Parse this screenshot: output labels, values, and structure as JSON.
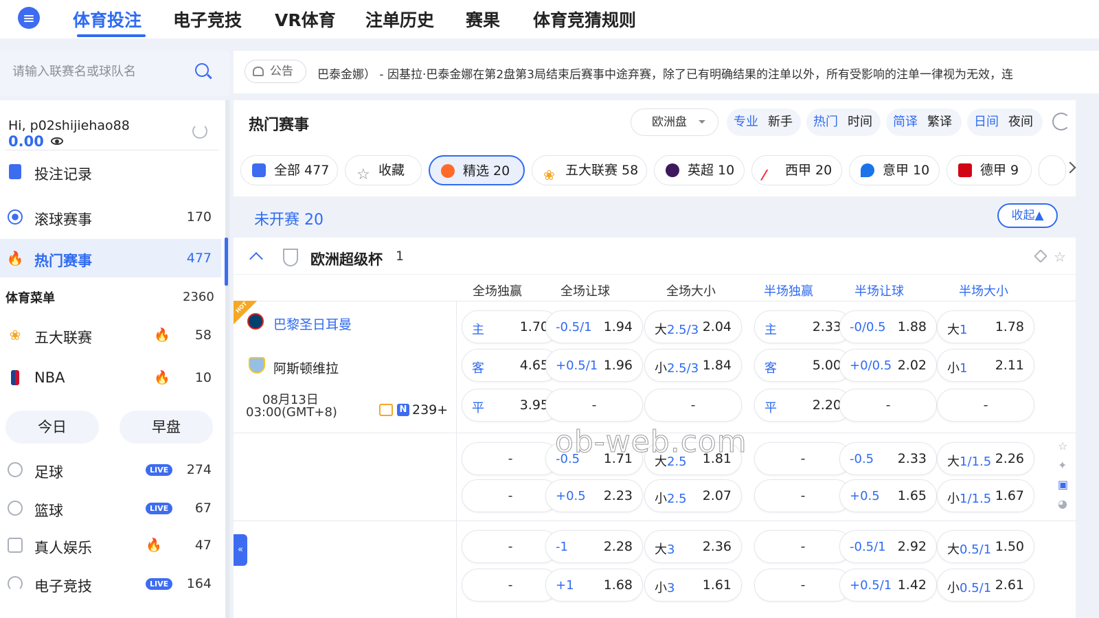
{
  "nav": {
    "items": [
      "体育投注",
      "电子竞技",
      "VR体育",
      "注单历史",
      "赛果",
      "体育竞猜规则"
    ],
    "active": "体育投注"
  },
  "search": {
    "placeholder": "请输入联赛名或球队名"
  },
  "user": {
    "greeting": "Hi, p02shijiehao88",
    "balance": "0.00"
  },
  "sidebar": {
    "bet_records": "投注记录",
    "live_matches": {
      "label": "滚球赛事",
      "count": "170"
    },
    "hot_matches": {
      "label": "热门赛事",
      "count": "477"
    },
    "sports_menu": {
      "label": "体育菜单",
      "count": "2360"
    },
    "leagues": [
      {
        "label": "五大联赛",
        "count": "58"
      },
      {
        "label": "NBA",
        "count": "10"
      }
    ],
    "tabs": [
      "今日",
      "早盘"
    ],
    "sports": [
      {
        "label": "足球",
        "badge": "LIVE",
        "count": "274"
      },
      {
        "label": "篮球",
        "badge": "LIVE",
        "count": "67"
      },
      {
        "label": "真人娱乐",
        "badge": "fire",
        "count": "47"
      },
      {
        "label": "电子竞技",
        "badge": "LIVE",
        "count": "164"
      }
    ],
    "collapse_symbol": "«"
  },
  "announcement": {
    "tag": "公告",
    "text": "巴泰金娜） - 因基拉·巴泰金娜在第2盘第3局结束后赛事中途弃赛，除了已有明确结果的注单以外，所有受影响的注单一律视为无效，连"
  },
  "main": {
    "title": "热门赛事",
    "odds_type": "欧洲盘",
    "toggles": [
      {
        "on": "专业",
        "off": "新手"
      },
      {
        "on": "热门",
        "off": "时间"
      },
      {
        "on": "简译",
        "off": "繁译"
      },
      {
        "on": "日间",
        "off": "夜间"
      }
    ],
    "chips": [
      {
        "label": "全部 477"
      },
      {
        "label": "收藏"
      },
      {
        "label": "精选 20"
      },
      {
        "label": "五大联赛 58"
      },
      {
        "label": "英超 10"
      },
      {
        "label": "西甲 20"
      },
      {
        "label": "意甲 10"
      },
      {
        "label": "德甲 9"
      }
    ],
    "not_started": "未开赛 20",
    "collapse_label": "收起▲",
    "league": {
      "name": "欧洲超级杯",
      "count": "1"
    },
    "columns": [
      "全场独赢",
      "全场让球",
      "全场大小",
      "半场独赢",
      "半场让球",
      "半场大小"
    ],
    "hot_tag": "HOT",
    "match": {
      "home": "巴黎圣日耳曼",
      "away": "阿斯顿维拉",
      "date": "08月13日",
      "time": "03:00(GMT+8)",
      "n_badge": "N",
      "more": "239+"
    },
    "rows": [
      [
        {
          "lb": "主",
          "od": "1.70"
        },
        {
          "lb": "-0.5/1",
          "od": "1.94"
        },
        {
          "lbp": "大",
          "lb": "2.5/3",
          "od": "2.04"
        },
        {
          "lb": "主",
          "od": "2.33"
        },
        {
          "lb": "-0/0.5",
          "od": "1.88"
        },
        {
          "lbp": "大",
          "lb": "1",
          "od": "1.78"
        }
      ],
      [
        {
          "lb": "客",
          "od": "4.65"
        },
        {
          "lb": "+0.5/1",
          "od": "1.96"
        },
        {
          "lbp": "小",
          "lb": "2.5/3",
          "od": "1.84"
        },
        {
          "lb": "客",
          "od": "5.00"
        },
        {
          "lb": "+0/0.5",
          "od": "2.02"
        },
        {
          "lbp": "小",
          "lb": "1",
          "od": "2.11"
        }
      ],
      [
        {
          "lb": "平",
          "od": "3.95"
        },
        {
          "dash": "-"
        },
        {
          "dash": "-"
        },
        {
          "lb": "平",
          "od": "2.20"
        },
        {
          "dash": "-"
        },
        {
          "dash": "-"
        }
      ],
      [
        {
          "dash": "-"
        },
        {
          "lb": "-0.5",
          "od": "1.71"
        },
        {
          "lbp": "大",
          "lb": "2.5",
          "od": "1.81"
        },
        {
          "dash": "-"
        },
        {
          "lb": "-0.5",
          "od": "2.33"
        },
        {
          "lbp": "大",
          "lb": "1/1.5",
          "od": "2.26"
        }
      ],
      [
        {
          "dash": "-"
        },
        {
          "lb": "+0.5",
          "od": "2.23"
        },
        {
          "lbp": "小",
          "lb": "2.5",
          "od": "2.07"
        },
        {
          "dash": "-"
        },
        {
          "lb": "+0.5",
          "od": "1.65"
        },
        {
          "lbp": "小",
          "lb": "1/1.5",
          "od": "1.67"
        }
      ],
      [
        {
          "dash": "-"
        },
        {
          "lb": "-1",
          "od": "2.28"
        },
        {
          "lbp": "大",
          "lb": "3",
          "od": "2.36"
        },
        {
          "dash": "-"
        },
        {
          "lb": "-0.5/1",
          "od": "2.92"
        },
        {
          "lbp": "大",
          "lb": "0.5/1",
          "od": "1.50"
        }
      ],
      [
        {
          "dash": "-"
        },
        {
          "lb": "+1",
          "od": "1.68"
        },
        {
          "lbp": "小",
          "lb": "3",
          "od": "1.61"
        },
        {
          "dash": "-"
        },
        {
          "lb": "+0.5/1",
          "od": "1.42"
        },
        {
          "lbp": "小",
          "lb": "0.5/1",
          "od": "2.61"
        }
      ]
    ]
  },
  "watermark": "ob-web.com",
  "colors": {
    "accent": "#2f6bf0",
    "hot": "#f6a723",
    "fire": "#ff5a1f"
  },
  "icons": [
    "menu-icon",
    "search-icon",
    "eye-icon",
    "refresh-icon",
    "bell-icon",
    "star-icon",
    "pin-icon",
    "trophy-icon",
    "fire-icon",
    "chevron-up-icon",
    "chevron-right-icon"
  ]
}
